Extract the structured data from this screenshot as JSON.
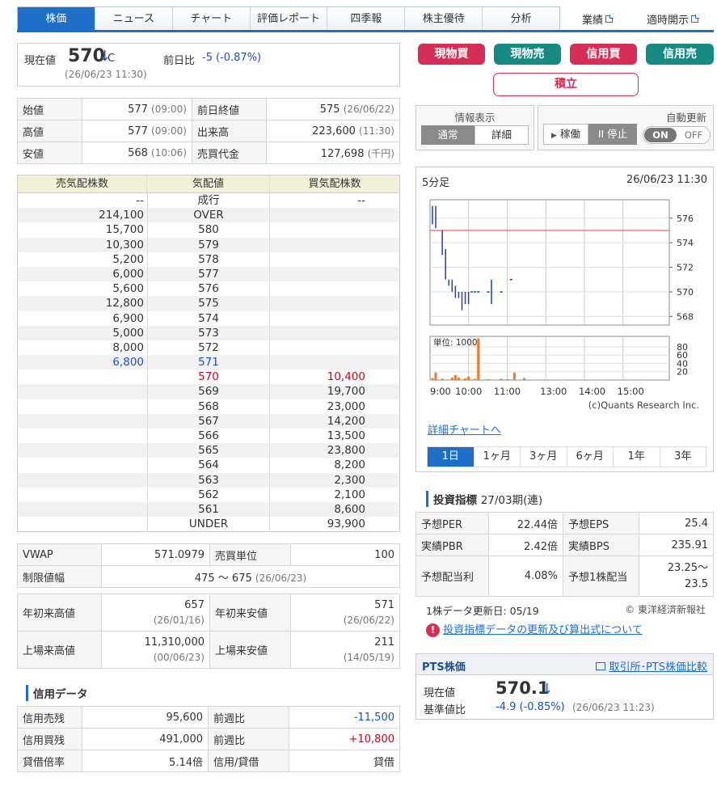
{
  "tabs": [
    "株価",
    "ニュース",
    "チャート",
    "評価レポート",
    "四季報",
    "株主優待",
    "分析"
  ],
  "links": {
    "results": "業績",
    "disclosure": "適時開示"
  },
  "price": {
    "label": "現在値",
    "value": "570",
    "arrow": "↓",
    "suffix": "C",
    "time": "(26/06/23 11:30)",
    "change_label": "前日比",
    "change": "-5",
    "change_pct": "(-0.87%)"
  },
  "stats": [
    {
      "l1": "始値",
      "v1": "577",
      "t1": "(09:00)",
      "l2": "前日終値",
      "v2": "575",
      "t2": "(26/06/22)"
    },
    {
      "l1": "高値",
      "v1": "577",
      "t1": "(09:00)",
      "l2": "出来高",
      "v2": "223,600",
      "t2": "(11:30)"
    },
    {
      "l1": "安値",
      "v1": "568",
      "t1": "(10:06)",
      "l2": "売買代金",
      "v2": "127,698",
      "t2": "(千円)"
    }
  ],
  "board": {
    "headers": [
      "売気配株数",
      "気配値",
      "買気配株数"
    ],
    "rows": [
      [
        "--",
        "成行",
        "--"
      ],
      [
        "214,100",
        "OVER",
        ""
      ],
      [
        "15,700",
        "580",
        ""
      ],
      [
        "10,300",
        "579",
        ""
      ],
      [
        "5,200",
        "578",
        ""
      ],
      [
        "6,000",
        "577",
        ""
      ],
      [
        "5,600",
        "576",
        ""
      ],
      [
        "12,800",
        "575",
        ""
      ],
      [
        "6,900",
        "574",
        ""
      ],
      [
        "5,000",
        "573",
        ""
      ],
      [
        "8,000",
        "572",
        ""
      ],
      [
        "6,800",
        "571",
        ""
      ],
      [
        "",
        "570",
        "10,400"
      ],
      [
        "",
        "569",
        "19,700"
      ],
      [
        "",
        "568",
        "23,000"
      ],
      [
        "",
        "567",
        "14,200"
      ],
      [
        "",
        "566",
        "13,500"
      ],
      [
        "",
        "565",
        "23,800"
      ],
      [
        "",
        "564",
        "8,200"
      ],
      [
        "",
        "563",
        "2,300"
      ],
      [
        "",
        "562",
        "2,100"
      ],
      [
        "",
        "561",
        "8,600"
      ],
      [
        "",
        "UNDER",
        "93,900"
      ]
    ]
  },
  "vwap": {
    "label": "VWAP",
    "value": "571.0979",
    "unit_label": "売買単位",
    "unit": "100",
    "limit_label": "制限値幅",
    "limit": "475 ～ 675",
    "limit_date": "(26/06/23)"
  },
  "highs": [
    {
      "l1": "年初来高値",
      "v1": "657",
      "d1": "(26/01/16)",
      "l2": "年初来安値",
      "v2": "571",
      "d2": "(26/06/22)"
    },
    {
      "l1": "上場来高値",
      "v1": "11,310,000",
      "d1": "(00/06/23)",
      "l2": "上場来安値",
      "v2": "211",
      "d2": "(14/05/19)"
    }
  ],
  "credit": {
    "title": "信用データ",
    "rows": [
      {
        "l1": "信用売残",
        "v1": "95,600",
        "l2": "前週比",
        "v2": "-11,500",
        "color": "#1d4fc8"
      },
      {
        "l1": "信用買残",
        "v1": "491,000",
        "l2": "前週比",
        "v2": "+10,800",
        "color": "#d0021b"
      },
      {
        "l1": "貸借倍率",
        "v1": "5.14倍",
        "l2": "信用/貸借",
        "v2": "貸借",
        "color": "#333"
      }
    ]
  },
  "trade_buttons": [
    "現物買",
    "現物売",
    "信用買",
    "信用売"
  ],
  "accum": "積立",
  "info": {
    "title": "情報表示",
    "normal": "通常",
    "detail": "詳細"
  },
  "auto": {
    "title": "自動更新",
    "run": "稼働",
    "stop": "II 停止",
    "on": "ON",
    "off": "OFF"
  },
  "chart": {
    "title": "5分足",
    "time": "26/06/23 11:30",
    "unit_label": "単位: 1000",
    "credit": "(c)Quants Research Inc.",
    "detail_link": "詳細チャートへ"
  },
  "chart_data": {
    "type": "line",
    "price_ticks": [
      576,
      574,
      572,
      570,
      568
    ],
    "ref_price": 575,
    "vol_ticks": [
      80,
      60,
      40,
      20
    ],
    "time_ticks": [
      "9:00",
      "10:00",
      "11:00",
      "13:00",
      "14:00",
      "15:00"
    ],
    "bars": [
      {
        "t": 0,
        "hi": 577,
        "lo": 575.5
      },
      {
        "t": 1,
        "hi": 577,
        "lo": 575.2
      },
      {
        "t": 3,
        "hi": 575,
        "lo": 573
      },
      {
        "t": 4,
        "hi": 573.5,
        "lo": 571
      },
      {
        "t": 5,
        "hi": 571,
        "lo": 570.5
      },
      {
        "t": 6,
        "hi": 571,
        "lo": 570
      },
      {
        "t": 7,
        "hi": 570.5,
        "lo": 569.5
      },
      {
        "t": 8,
        "hi": 570,
        "lo": 569.5
      },
      {
        "t": 9,
        "hi": 570,
        "lo": 568.5
      },
      {
        "t": 10,
        "hi": 570,
        "lo": 569
      },
      {
        "t": 11,
        "hi": 570,
        "lo": 569
      },
      {
        "t": 12,
        "hi": 570,
        "lo": 570
      },
      {
        "t": 13,
        "hi": 570,
        "lo": 570
      },
      {
        "t": 14,
        "hi": 570,
        "lo": 570
      },
      {
        "t": 17,
        "hi": 570,
        "lo": 570
      },
      {
        "t": 18,
        "hi": 571,
        "lo": 569
      },
      {
        "t": 21,
        "hi": 570,
        "lo": 570
      },
      {
        "t": 24,
        "hi": 571,
        "lo": 571
      }
    ],
    "volumes": [
      {
        "t": 0,
        "v": 5
      },
      {
        "t": 1,
        "v": 18
      },
      {
        "t": 3,
        "v": 3
      },
      {
        "t": 6,
        "v": 6
      },
      {
        "t": 7,
        "v": 12
      },
      {
        "t": 8,
        "v": 6
      },
      {
        "t": 10,
        "v": 4
      },
      {
        "t": 11,
        "v": 8
      },
      {
        "t": 13,
        "v": 3
      },
      {
        "t": 14,
        "v": 100
      },
      {
        "t": 17,
        "v": 2
      },
      {
        "t": 21,
        "v": 3
      },
      {
        "t": 23,
        "v": 2
      },
      {
        "t": 25,
        "v": 18
      },
      {
        "t": 28,
        "v": 5
      }
    ]
  },
  "periods": [
    "1日",
    "1ヶ月",
    "3ヶ月",
    "6ヶ月",
    "1年",
    "3年"
  ],
  "indicators": {
    "title": "投資指標",
    "period": "27/03期(連)",
    "rows": [
      {
        "l1": "予想PER",
        "v1": "22.44倍",
        "l2": "予想EPS",
        "v2": "25.4"
      },
      {
        "l1": "実績PBR",
        "v1": "2.42倍",
        "l2": "実績BPS",
        "v2": "235.91"
      },
      {
        "l1": "予想配当利",
        "v1": "4.08%",
        "l2": "予想1株配当",
        "v2": "23.25～",
        "v3": "23.5"
      }
    ],
    "update": "1株データ更新日: 05/19",
    "source": "© 東洋経済新報社",
    "notice": "投資指標データの更新及び算出式について"
  },
  "pts": {
    "title": "PTS株価",
    "compare": "取引所･PTS株価比較",
    "price_label": "現在値",
    "price": "570.1",
    "arrow": "↓",
    "base_label": "基準値比",
    "change": "-4.9",
    "pct": "(-0.85%)",
    "time": "(26/06/23 11:23)"
  }
}
